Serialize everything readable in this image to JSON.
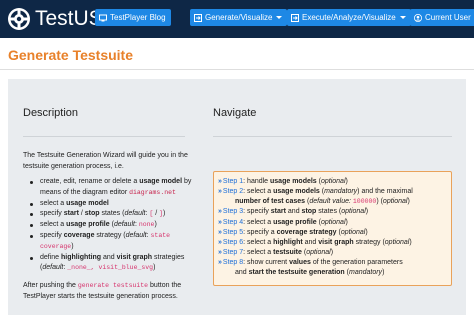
{
  "app": {
    "brand": "TestUS"
  },
  "navbar": {
    "blog_label": "TestPlayer Blog",
    "generate_label": "Generate/Visualize",
    "execute_label": "Execute/Analyze/Visualize",
    "user_label": "Current User"
  },
  "page": {
    "title": "Generate Testsuite"
  },
  "description": {
    "heading": "Description",
    "intro": "The Testsuite Generation Wizard will guide you in the testsuite generation process, i.e.",
    "items": [
      {
        "t1": "create, edit, rename or delete a ",
        "b1": "usage model",
        "t2": " by means of the diagram editor ",
        "code": "diagrams.net"
      },
      {
        "t1": "select a ",
        "b1": "usage model"
      },
      {
        "t1": "specify ",
        "b1": "start",
        "t2": " / ",
        "b2": "stop",
        "t3": " states (",
        "i1": "default",
        "t4": ": ",
        "code1": "[",
        "t5": " / ",
        "code2": "]",
        "t6": ")"
      },
      {
        "t1": "select a ",
        "b1": "usage profile",
        "t2": " (",
        "i1": "default",
        "t3": ": ",
        "code": "none",
        "t4": ")"
      },
      {
        "t1": "specify ",
        "b1": "coverage",
        "t2": " strategy (",
        "i1": "default",
        "t3": ": ",
        "code": "state coverage",
        "t4": ")"
      },
      {
        "t1": "define ",
        "b1": "highlighting",
        "t2": " and ",
        "b2": "visit graph",
        "t3": " strategies (",
        "i1": "default",
        "t4": ": ",
        "code": "_none_, visit_blue_svg",
        "t5": ")"
      }
    ],
    "after_1": "After pushing the ",
    "after_code": "generate testsuite",
    "after_2": " button the TestPlayer starts the testsuite generation process."
  },
  "navigate": {
    "heading": "Navigate",
    "steps": [
      {
        "label": "Step 1",
        "t1": ": handle ",
        "b1": "usage models",
        "t2": " (",
        "i1": "optional",
        "t3": ")"
      },
      {
        "label": "Step 2",
        "t1": ": select a ",
        "b1": "usage models",
        "t2": " (",
        "i1": "mandatory",
        "t3": ") and the maximal",
        "cont_b": "number of test cases",
        "cont_t1": " (",
        "cont_i": "default value: ",
        "cont_code": "100000",
        "cont_t2": ") (",
        "cont_i2": "optional",
        "cont_t3": ")"
      },
      {
        "label": "Step 3",
        "t1": ": specify ",
        "b1": "start",
        "t2": " and ",
        "b2": "stop",
        "t3": " states (",
        "i1": "optional",
        "t4": ")"
      },
      {
        "label": "Step 4",
        "t1": ": select a ",
        "b1": "usage profile",
        "t2": " (",
        "i1": "optional",
        "t3": ")"
      },
      {
        "label": "Step 5",
        "t1": ": specify a ",
        "b1": "coverage strategy",
        "t2": " (",
        "i1": "optional",
        "t3": ")"
      },
      {
        "label": "Step 6",
        "t1": ": select a ",
        "b1": "highlight",
        "t2": " and ",
        "b2": "visit graph",
        "t3": " strategy (",
        "i1": "optional",
        "t4": ")"
      },
      {
        "label": "Step 7",
        "t1": ": select a ",
        "b1": "testsuite",
        "t2": " (",
        "i1": "optional",
        "t3": ")"
      },
      {
        "label": "Step 8",
        "t1": ": show current ",
        "b1": "values",
        "t2": " of the generation parameters",
        "cont_t0": "and ",
        "cont_b": "start the testsuite generation",
        "cont_t1": " (",
        "cont_i": "mandatory",
        "cont_t2": ")"
      }
    ]
  },
  "colors": {
    "navbar_bg": "#0e2746",
    "button_bg": "#1e88e5",
    "title_orange": "#e8812a",
    "panel_bg": "#e9ecef",
    "step_link": "#1e6fd9",
    "code_pink": "#d6336c"
  },
  "icons": {
    "brand": "gear-logo-icon",
    "blog": "tv-icon",
    "generate": "arrow-right-square-icon",
    "execute": "arrow-right-square-icon",
    "user": "user-circle-icon",
    "step": "double-chevron-right-icon"
  }
}
